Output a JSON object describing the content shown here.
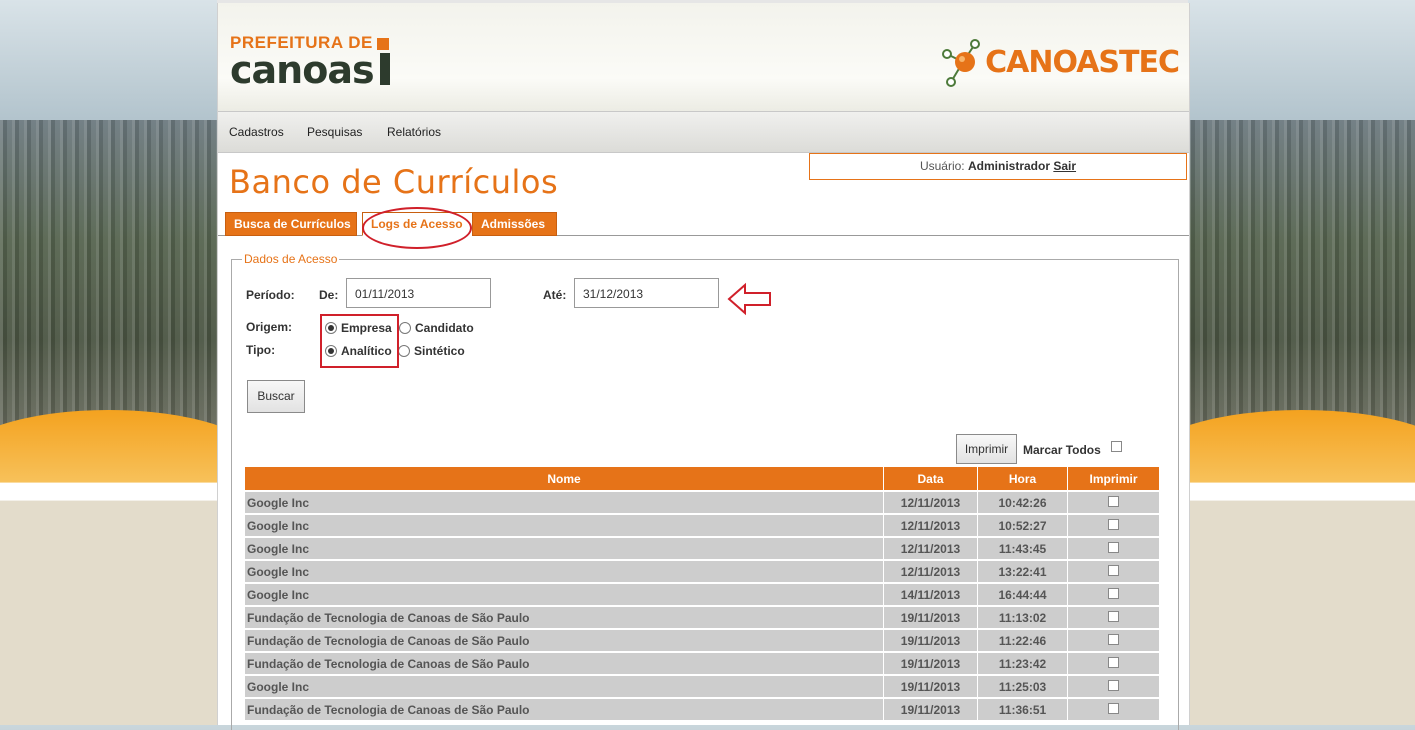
{
  "header": {
    "logo_prefeitura_top": "PREFEITURA DE",
    "logo_prefeitura_bottom": "canoas",
    "logo_canoastec": "CANOASTEC"
  },
  "menu": [
    "Cadastros",
    "Pesquisas",
    "Relatórios"
  ],
  "user": {
    "label": "Usuário:",
    "name": "Administrador",
    "logout": "Sair"
  },
  "page_title": "Banco de Currículos",
  "tabs": [
    "Busca de Currículos",
    "Logs de Acesso",
    "Admissões"
  ],
  "form": {
    "legend": "Dados de Acesso",
    "periodo_label": "Período:",
    "de_label": "De:",
    "de_value": "01/11/2013",
    "ate_label": "Até:",
    "ate_value": "31/12/2013",
    "origem_label": "Origem:",
    "origem_options": [
      "Empresa",
      "Candidato"
    ],
    "origem_selected": "Empresa",
    "tipo_label": "Tipo:",
    "tipo_options": [
      "Analítico",
      "Sintético"
    ],
    "tipo_selected": "Analítico",
    "buscar": "Buscar"
  },
  "results": {
    "imprimir_button": "Imprimir",
    "marcar_todos": "Marcar Todos",
    "columns": [
      "Nome",
      "Data",
      "Hora",
      "Imprimir"
    ],
    "rows": [
      {
        "nome": "Google Inc",
        "data": "12/11/2013",
        "hora": "10:42:26"
      },
      {
        "nome": "Google Inc",
        "data": "12/11/2013",
        "hora": "10:52:27"
      },
      {
        "nome": "Google Inc",
        "data": "12/11/2013",
        "hora": "11:43:45"
      },
      {
        "nome": "Google Inc",
        "data": "12/11/2013",
        "hora": "13:22:41"
      },
      {
        "nome": "Google Inc",
        "data": "14/11/2013",
        "hora": "16:44:44"
      },
      {
        "nome": "Fundação de Tecnologia de Canoas de São Paulo",
        "data": "19/11/2013",
        "hora": "11:13:02"
      },
      {
        "nome": "Fundação de Tecnologia de Canoas de São Paulo",
        "data": "19/11/2013",
        "hora": "11:22:46"
      },
      {
        "nome": "Fundação de Tecnologia de Canoas de São Paulo",
        "data": "19/11/2013",
        "hora": "11:23:42"
      },
      {
        "nome": "Google Inc",
        "data": "19/11/2013",
        "hora": "11:25:03"
      },
      {
        "nome": "Fundação de Tecnologia de Canoas de São Paulo",
        "data": "19/11/2013",
        "hora": "11:36:51"
      }
    ]
  },
  "colors": {
    "accent": "#e67318",
    "dark_green": "#2d3b2d",
    "annotation_red": "#d0202a",
    "row_gray": "#cdcdcd"
  }
}
